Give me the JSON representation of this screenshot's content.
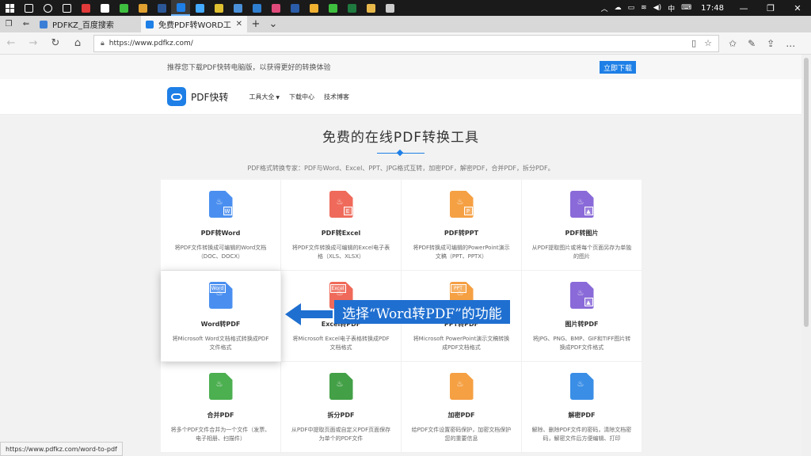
{
  "taskbar": {
    "apps": [
      {
        "name": "search-icon",
        "color": "#ffffff"
      },
      {
        "name": "cortana-icon",
        "color": "#ffffff"
      },
      {
        "name": "task-view-icon",
        "color": "#ffffff"
      },
      {
        "name": "app-red-icon",
        "color": "#e03a3a"
      },
      {
        "name": "file-icon",
        "color": "#ffffff"
      },
      {
        "name": "app-green-icon",
        "color": "#3fbf3f"
      },
      {
        "name": "weibo-icon",
        "color": "#e0a030"
      },
      {
        "name": "word-icon",
        "color": "#2b5797"
      },
      {
        "name": "edge-icon",
        "color": "#1e7fe6"
      },
      {
        "name": "bird-icon",
        "color": "#44aaff"
      },
      {
        "name": "chrome-icon",
        "color": "#e0c030"
      },
      {
        "name": "photos-icon",
        "color": "#4a90d9"
      },
      {
        "name": "ie-icon",
        "color": "#2f7fd0"
      },
      {
        "name": "app-pink-icon",
        "color": "#e04a7a"
      },
      {
        "name": "photoshop-icon",
        "color": "#2a5ca8"
      },
      {
        "name": "face-icon",
        "color": "#f0b030"
      },
      {
        "name": "wechat-icon",
        "color": "#3fbf3f"
      },
      {
        "name": "excel-icon",
        "color": "#1f7a3f"
      },
      {
        "name": "folder-icon",
        "color": "#e8b84a"
      },
      {
        "name": "mail-icon",
        "color": "#cccccc"
      }
    ],
    "ime": "中",
    "time": "17:48"
  },
  "tabs": [
    {
      "title": "PDFKZ_百度搜索",
      "favicon_color": "#3a7fd5",
      "active": false
    },
    {
      "title": "免费PDF转WORD工具[F",
      "favicon_color": "#1e7fe6",
      "active": true
    }
  ],
  "address": {
    "url": "https://www.pdfkz.com/"
  },
  "promo": {
    "text": "推荐您下载PDF快转电脑版，以获得更好的转换体验",
    "button": "立即下载"
  },
  "header": {
    "brand": "PDF快转",
    "nav": [
      "工具大全",
      "下载中心",
      "技术博客"
    ]
  },
  "hero": {
    "title": "免费的在线PDF转换工具",
    "subtitle": "PDF格式转换专家：PDF与Word、Excel、PPT、JPG格式互转，加密PDF，解密PDF，合并PDF，拆分PDF。"
  },
  "cards": [
    {
      "title": "PDF转Word",
      "desc": "将PDF文件转换成可编辑的Word文档（DOC、DOCX）",
      "color": "#4a8ff0",
      "badge": "W",
      "icon": "pdf-to-word-icon"
    },
    {
      "title": "PDF转Excel",
      "desc": "将PDF文件转换成可编辑的Excel电子表格（XLS、XLSX）",
      "color": "#ef6a5a",
      "badge": "E",
      "icon": "pdf-to-excel-icon"
    },
    {
      "title": "PDF转PPT",
      "desc": "将PDF转换成可编辑的PowerPoint演示文稿（PPT、PPTX）",
      "color": "#f5a043",
      "badge": "P",
      "icon": "pdf-to-ppt-icon"
    },
    {
      "title": "PDF转图片",
      "desc": "从PDF提取图片或将每个页面另存为单独的图片",
      "color": "#8a6ad8",
      "badge": "▲",
      "icon": "pdf-to-image-icon"
    },
    {
      "title": "Word转PDF",
      "desc": "将Microsoft Word文档格式转换成PDF文件格式",
      "color": "#4a8ff0",
      "badge": "Word",
      "icon": "word-to-pdf-icon"
    },
    {
      "title": "Excel转PDF",
      "desc": "将Microsoft Excel电子表格转换成PDF文档格式",
      "color": "#ef6a5a",
      "badge": "Excel",
      "icon": "excel-to-pdf-icon"
    },
    {
      "title": "PPT转PDF",
      "desc": "将Microsoft PowerPoint演示文稿转换成PDF文档格式",
      "color": "#f5a043",
      "badge": "PPT",
      "icon": "ppt-to-pdf-icon"
    },
    {
      "title": "图片转PDF",
      "desc": "将JPG、PNG、BMP、GIF和TIFF图片转换成PDF文件格式",
      "color": "#8a6ad8",
      "badge": "▲",
      "icon": "image-to-pdf-icon"
    },
    {
      "title": "合并PDF",
      "desc": "将多个PDF文件合并为一个文件（发票、电子相册、扫描件）",
      "color": "#4caf50",
      "badge": "",
      "icon": "merge-pdf-icon"
    },
    {
      "title": "拆分PDF",
      "desc": "从PDF中提取页面或自定义PDF页面保存为单个的PDF文件",
      "color": "#43a047",
      "badge": "",
      "icon": "split-pdf-icon"
    },
    {
      "title": "加密PDF",
      "desc": "给PDF文件设置密码保护，加密文档保护您的重要信息",
      "color": "#f5a043",
      "badge": "",
      "icon": "encrypt-pdf-icon"
    },
    {
      "title": "解密PDF",
      "desc": "解除、删除PDF文件的密码，清除文档密码，解密文件后方便编辑、打印",
      "color": "#3a8ee6",
      "badge": "",
      "icon": "decrypt-pdf-icon"
    }
  ],
  "annotation": {
    "text": "选择“Word转PDF”的功能"
  },
  "status": {
    "text": "https://www.pdfkz.com/word-to-pdf"
  }
}
